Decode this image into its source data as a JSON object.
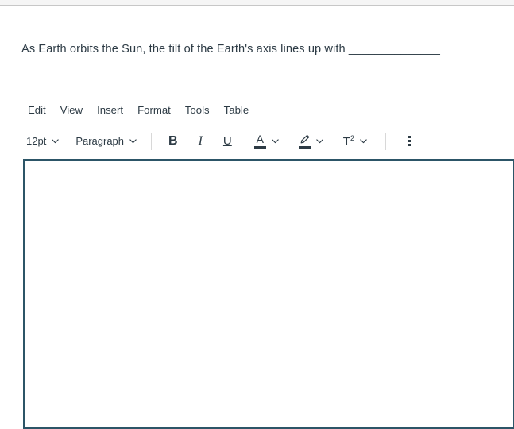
{
  "window": {
    "top_strip": "",
    "background_color": "#ffffff",
    "page_border_color": "#b6b6b6"
  },
  "question": {
    "text": "As Earth orbits the Sun, the tilt of the Earth's axis lines up with ______________"
  },
  "editor": {
    "menu_bar": {
      "items": [
        {
          "label": "Edit",
          "name": "menu-item-edit"
        },
        {
          "label": "View",
          "name": "menu-item-view"
        },
        {
          "label": "Insert",
          "name": "menu-item-insert"
        },
        {
          "label": "Format",
          "name": "menu-item-format"
        },
        {
          "label": "Tools",
          "name": "menu-item-tools"
        },
        {
          "label": "Table",
          "name": "menu-item-table"
        }
      ]
    },
    "toolbar": {
      "font_size": {
        "label": "12pt",
        "icon": "chevron-down-icon"
      },
      "block_format": {
        "label": "Paragraph",
        "icon": "chevron-down-icon"
      },
      "bold": {
        "label": "B",
        "icon": "bold-icon"
      },
      "italic": {
        "label": "I",
        "icon": "italic-icon"
      },
      "underline": {
        "label": "U",
        "icon": "underline-icon"
      },
      "text_color": {
        "label": "A",
        "icon": "text-color-icon",
        "swatch": "#2d3b45"
      },
      "highlight_color": {
        "label": "",
        "icon": "highlight-marker-icon",
        "swatch": "#2d3b45"
      },
      "superscript": {
        "label": "T",
        "exponent": "2",
        "icon": "superscript-icon"
      },
      "overflow": {
        "label": "",
        "icon": "kebab-menu-icon"
      }
    },
    "content": {
      "value": "",
      "placeholder": ""
    },
    "focus_border_color": "#2c5567"
  }
}
